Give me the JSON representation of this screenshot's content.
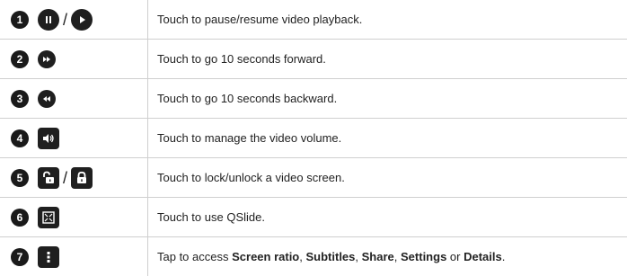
{
  "rows": [
    {
      "num": "1",
      "description": "Touch to pause/resume video playback."
    },
    {
      "num": "2",
      "description": "Touch to go 10 seconds forward."
    },
    {
      "num": "3",
      "description": "Touch to go 10 seconds backward."
    },
    {
      "num": "4",
      "description": "Touch to manage the video volume."
    },
    {
      "num": "5",
      "description": "Touch to lock/unlock a video screen."
    },
    {
      "num": "6",
      "description": "Touch to use QSlide."
    },
    {
      "num": "7",
      "description_parts": {
        "p0": "Tap to access ",
        "screen_ratio": "Screen ratio",
        "p1": ", ",
        "subtitles": "Subtitles",
        "p2": ", ",
        "share": "Share",
        "p3": ", ",
        "settings": "Settings",
        "p4": " or ",
        "details": "Details",
        "p5": "."
      }
    }
  ],
  "separators": {
    "slash": "/"
  },
  "icons": [
    "pause-icon",
    "play-icon",
    "fast-forward-icon",
    "rewind-icon",
    "volume-icon",
    "unlock-icon",
    "lock-icon",
    "qslide-icon",
    "more-options-icon"
  ]
}
